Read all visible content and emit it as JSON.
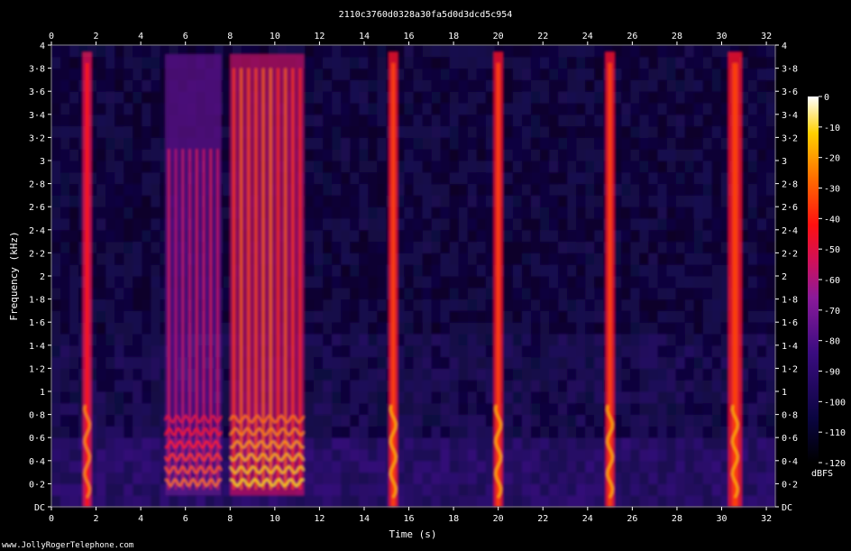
{
  "chart_data": {
    "type": "heatmap",
    "title": "2110c3760d0328a30fa5d0d3dcd5c954",
    "xlabel": "Time (s)",
    "ylabel": "Frequency (kHz)",
    "xlim": [
      0,
      32.4
    ],
    "ylim": [
      0,
      4
    ],
    "x_ticks": [
      "0",
      "2",
      "4",
      "6",
      "8",
      "10",
      "12",
      "14",
      "16",
      "18",
      "20",
      "22",
      "24",
      "26",
      "28",
      "30",
      "32"
    ],
    "y_ticks": [
      "DC",
      "0·2",
      "0·4",
      "0·6",
      "0·8",
      "1",
      "1·2",
      "1·4",
      "1·6",
      "1·8",
      "2",
      "2·2",
      "2·4",
      "2·6",
      "2·8",
      "3",
      "3·2",
      "3·4",
      "3·6",
      "3·8",
      "4"
    ],
    "colorbar": {
      "label": "dBFS",
      "ticks": [
        "0",
        "-10",
        "-20",
        "-30",
        "-40",
        "-50",
        "-60",
        "-70",
        "-80",
        "-90",
        "-100",
        "-110",
        "-120"
      ],
      "range": [
        -120,
        0
      ]
    },
    "events": [
      {
        "start": 1.4,
        "end": 1.8,
        "type": "tone-burst",
        "level_db": -55
      },
      {
        "start": 5.1,
        "end": 7.6,
        "type": "voice",
        "level_db": -60
      },
      {
        "start": 8.0,
        "end": 11.3,
        "type": "voice",
        "level_db": -45
      },
      {
        "start": 15.1,
        "end": 15.5,
        "type": "tone-burst",
        "level_db": -50
      },
      {
        "start": 19.8,
        "end": 20.2,
        "type": "tone-burst",
        "level_db": -50
      },
      {
        "start": 24.8,
        "end": 25.2,
        "type": "tone-burst",
        "level_db": -50
      },
      {
        "start": 30.3,
        "end": 30.9,
        "type": "tone-burst",
        "level_db": -50
      }
    ],
    "background_level_db": -105,
    "colors": {
      "background": "#000000",
      "low": "#0a0530",
      "mid": "#6a1b9a",
      "high": "#ff1a1a",
      "peak": "#ffff80"
    }
  },
  "watermark": "www.JollyRogerTelephone.com"
}
